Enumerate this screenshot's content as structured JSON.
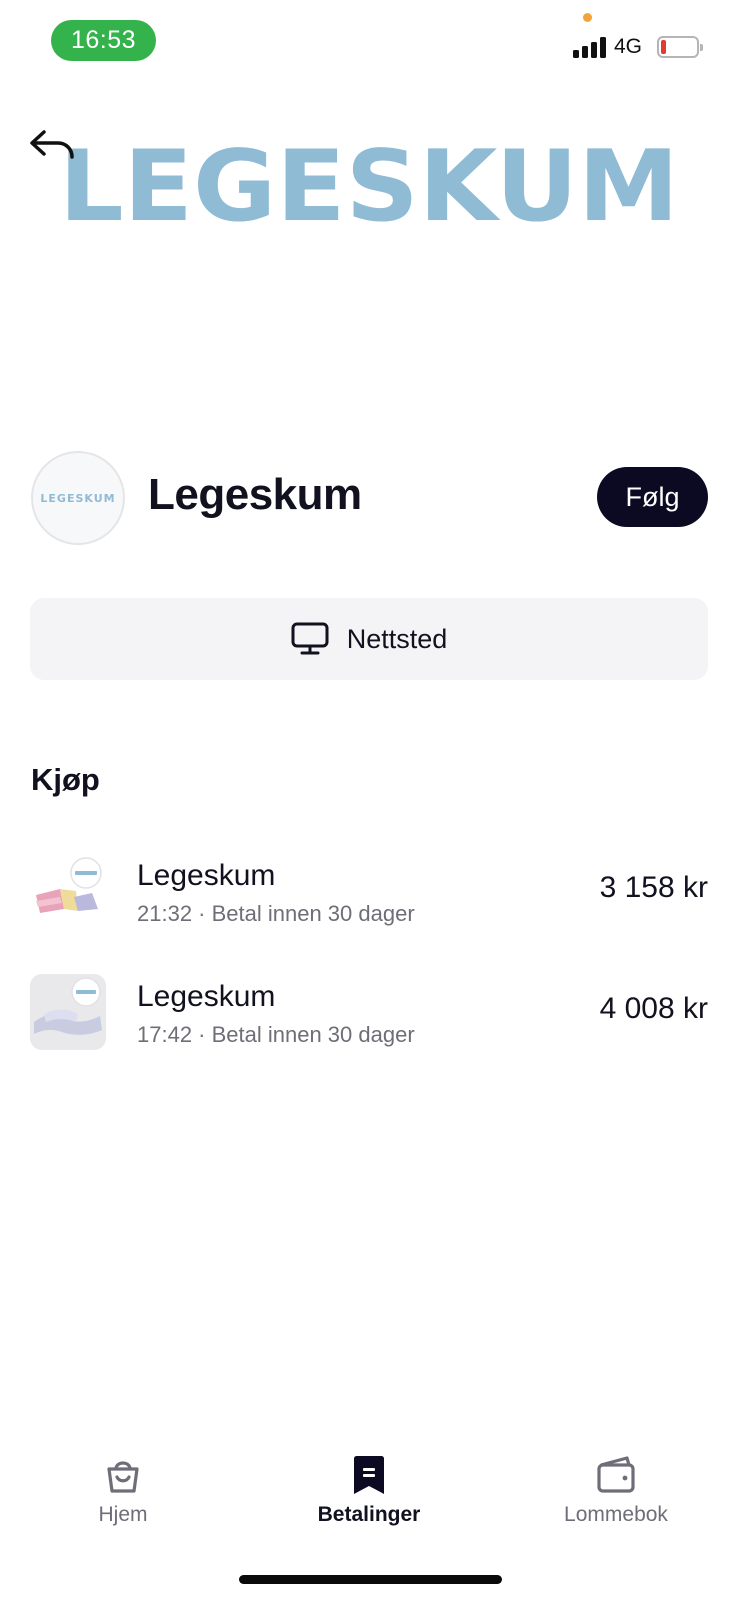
{
  "status_bar": {
    "time": "16:53",
    "network": "4G",
    "colors": {
      "time_pill": "#34b24c",
      "battery_low": "#e23b33",
      "dot": "#f2a33a"
    }
  },
  "banner": {
    "logo_text": "LEGESKUM",
    "logo_color": "#8fbbd5",
    "back_icon": "back-arrow-icon"
  },
  "merchant": {
    "avatar_text": "LEGESKUM",
    "name": "Legeskum",
    "follow_label": "Følg",
    "website_label": "Nettsted",
    "website_icon": "monitor-icon"
  },
  "purchases": {
    "title": "Kjøp",
    "items": [
      {
        "title": "Legeskum",
        "subtitle": "21:32 · Betal innen 30 dager",
        "amount": "3 158 kr"
      },
      {
        "title": "Legeskum",
        "subtitle": "17:42 · Betal innen 30 dager",
        "amount": "4 008 kr"
      }
    ]
  },
  "tabs": [
    {
      "label": "Hjem",
      "icon": "shopping-bag-icon",
      "active": false
    },
    {
      "label": "Betalinger",
      "icon": "receipt-icon",
      "active": true
    },
    {
      "label": "Lommebok",
      "icon": "wallet-icon",
      "active": false
    }
  ]
}
